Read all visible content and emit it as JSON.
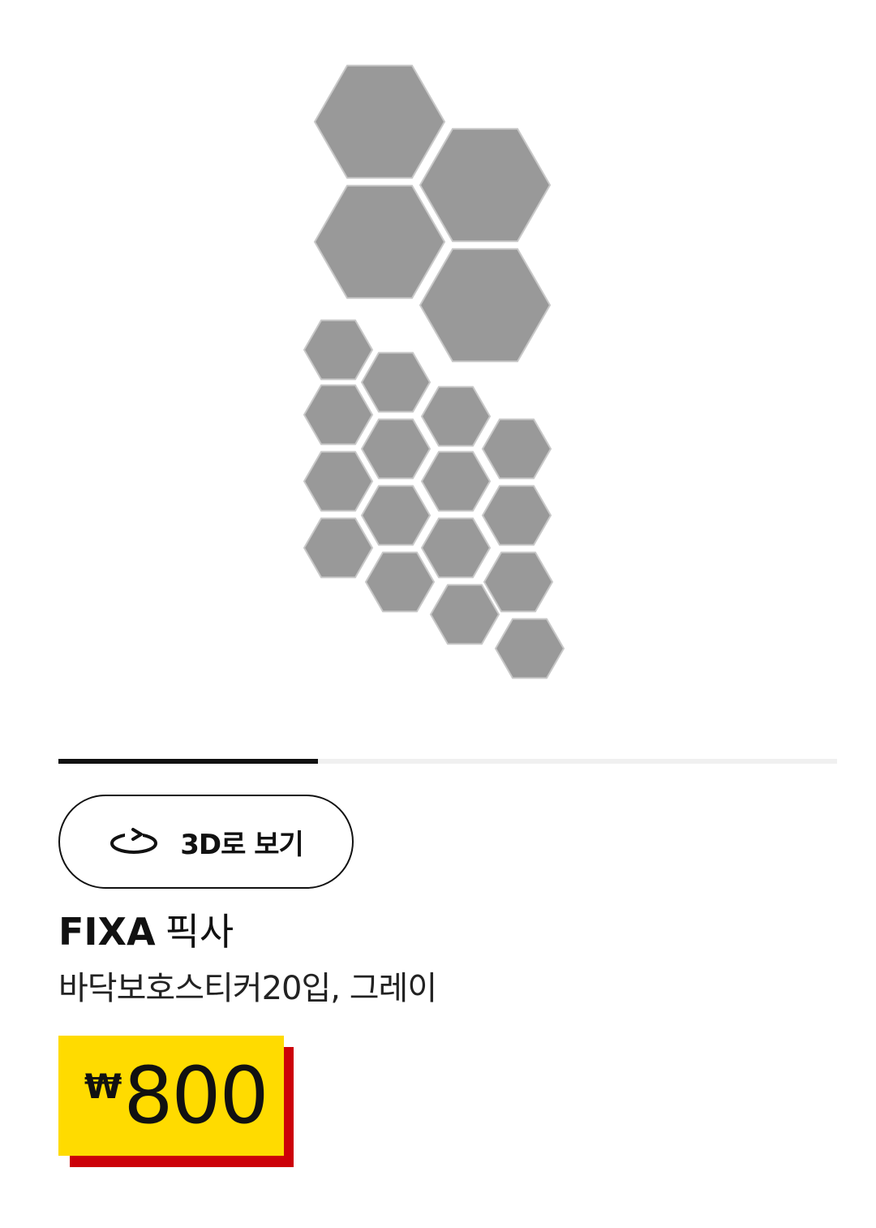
{
  "product": {
    "brand": "FIXA",
    "local_name": "픽사",
    "description": "바닥보호스티커20입, 그레이",
    "price_currency": "₩",
    "price_amount": "800"
  },
  "gallery": {
    "progress": 0.333
  },
  "view3d": {
    "label": "3D로 보기",
    "icon": "rotate-3d-icon"
  },
  "colors": {
    "price_bg": "#ffdb00",
    "price_shadow": "#cc0008",
    "pad": "#999999"
  }
}
